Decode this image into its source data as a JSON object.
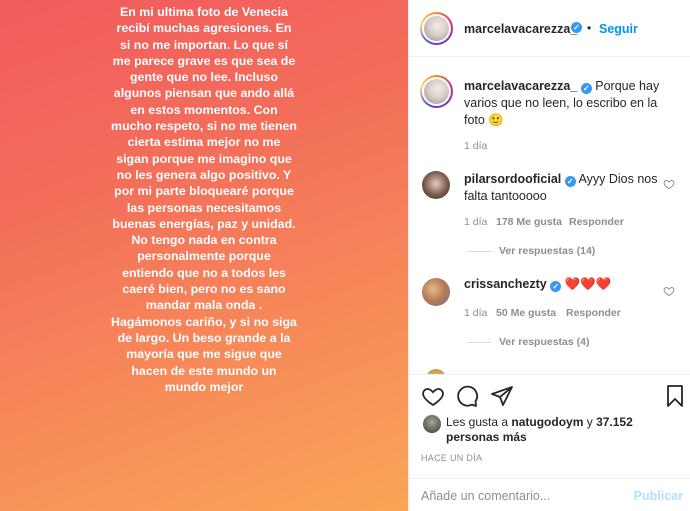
{
  "post": {
    "story_text": "En mi ultima foto de Venecia recibí muchas agresiones. En si no me importan. Lo que sí me parece grave es que sea de gente que no lee. Incluso algunos piensan que ando allá en estos momentos. Con mucho respeto, si no me tienen cierta estima mejor no me sigan porque me imagino que no les genera algo positivo. Y por mi parte bloquearé porque las personas necesitamos buenas energías, paz y unidad. No tengo nada en contra personalmente porque entiendo que no a todos les caeré bien, pero no es sano mandar mala onda . Hagámonos cariño, y si no siga de largo. Un beso grande a la mayoría que me sigue que hacen de este mundo un mundo mejor"
  },
  "header": {
    "username": "marcelavacarezza_",
    "separator": "•",
    "follow_label": "Seguir"
  },
  "caption": {
    "username": "marcelavacarezza_",
    "text": "Porque hay varios que no leen, lo escribo en la foto 🙂",
    "time": "1 día"
  },
  "comments": [
    {
      "username": "pilarsordooficial",
      "text": "Ayyy Dios nos falta tantooooo",
      "time": "1 día",
      "likes": "178 Me gusta",
      "reply": "Responder",
      "view_replies": "Ver respuestas (14)"
    },
    {
      "username": "crissanchezty",
      "text": "❤️❤️❤️",
      "time": "1 día",
      "likes": "50 Me gusta",
      "reply": "Responder",
      "view_replies": "Ver respuestas (4)"
    }
  ],
  "likes": {
    "prefix": "Les gusta a",
    "user": "natugodoym",
    "joiner": "y",
    "count": "37.152 personas más"
  },
  "date": "HACE UN DÍA",
  "add_comment": {
    "placeholder": "Añade un comentario...",
    "publish_label": "Publicar"
  },
  "colors": {
    "accent": "#0095f6",
    "verified": "#3897f0",
    "publish_disabled": "#b2dffc",
    "gradient_start": "#f25a5e",
    "gradient_end": "#f9a557"
  }
}
